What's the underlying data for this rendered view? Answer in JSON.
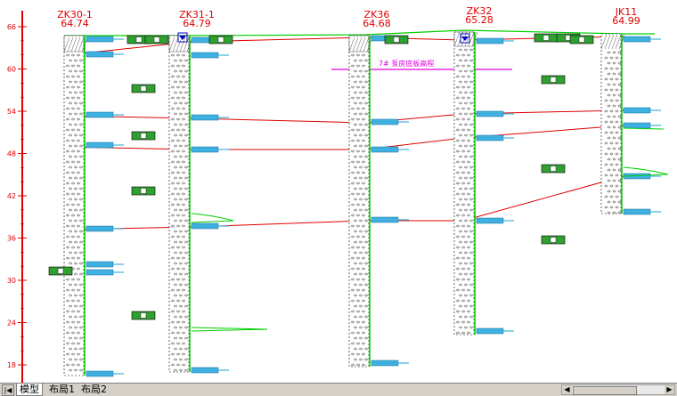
{
  "axis": {
    "ticks": [
      "66",
      "60",
      "54",
      "48",
      "42",
      "36",
      "30",
      "24",
      "18"
    ],
    "tick_values": [
      66,
      60,
      54,
      48,
      42,
      36,
      30,
      24,
      18
    ]
  },
  "boreholes": [
    {
      "id": "ZK30-1",
      "elev": "64.74"
    },
    {
      "id": "ZK31-1",
      "elev": "64.79"
    },
    {
      "id": "ZK36",
      "elev": "64.68"
    },
    {
      "id": "ZK32",
      "elev": "65.28"
    },
    {
      "id": "JK11",
      "elev": "64.99"
    }
  ],
  "annotation": {
    "text": "7# 泵房底板高程"
  },
  "tabs": {
    "model": "模型",
    "layout1": "布局1",
    "layout2": "布局2"
  },
  "colors": {
    "axis": "#e00000",
    "layer_line": "#e00000",
    "borehole": "#00c000",
    "magenta": "#e000e0",
    "label": "#00a0ff"
  }
}
